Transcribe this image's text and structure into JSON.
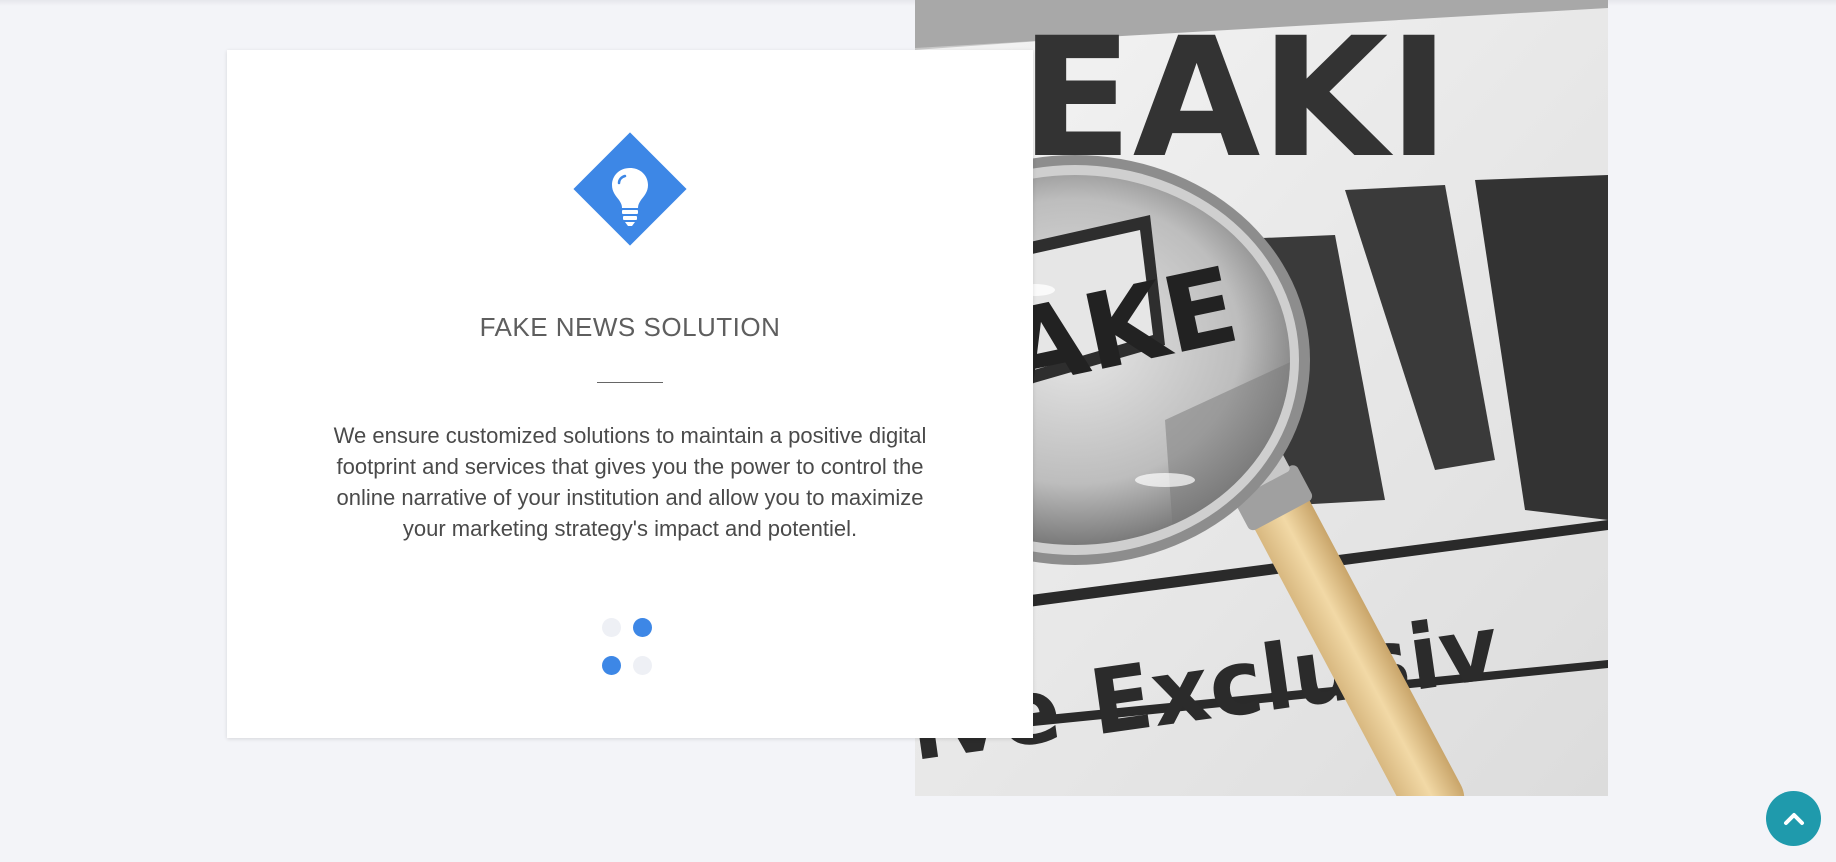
{
  "feature": {
    "icon": "lightbulb-icon",
    "title": "FAKE NEWS SOLUTION",
    "description": "We ensure customized solutions to maintain a positive digital footprint and services that gives you the power to control the online narrative of your institution and allow you to maximize your marketing strategy's impact and potentiel."
  },
  "photo": {
    "headline_fragment": "EAKI",
    "lens_word": "FAKE",
    "footer_fragment": "ive Exclusiv",
    "accent_color": "#3d87e6"
  },
  "carousel": {
    "dots": [
      "inactive",
      "active",
      "active",
      "inactive"
    ]
  },
  "scroll_top": {
    "icon": "chevron-up-icon",
    "color": "#1f9aac"
  }
}
